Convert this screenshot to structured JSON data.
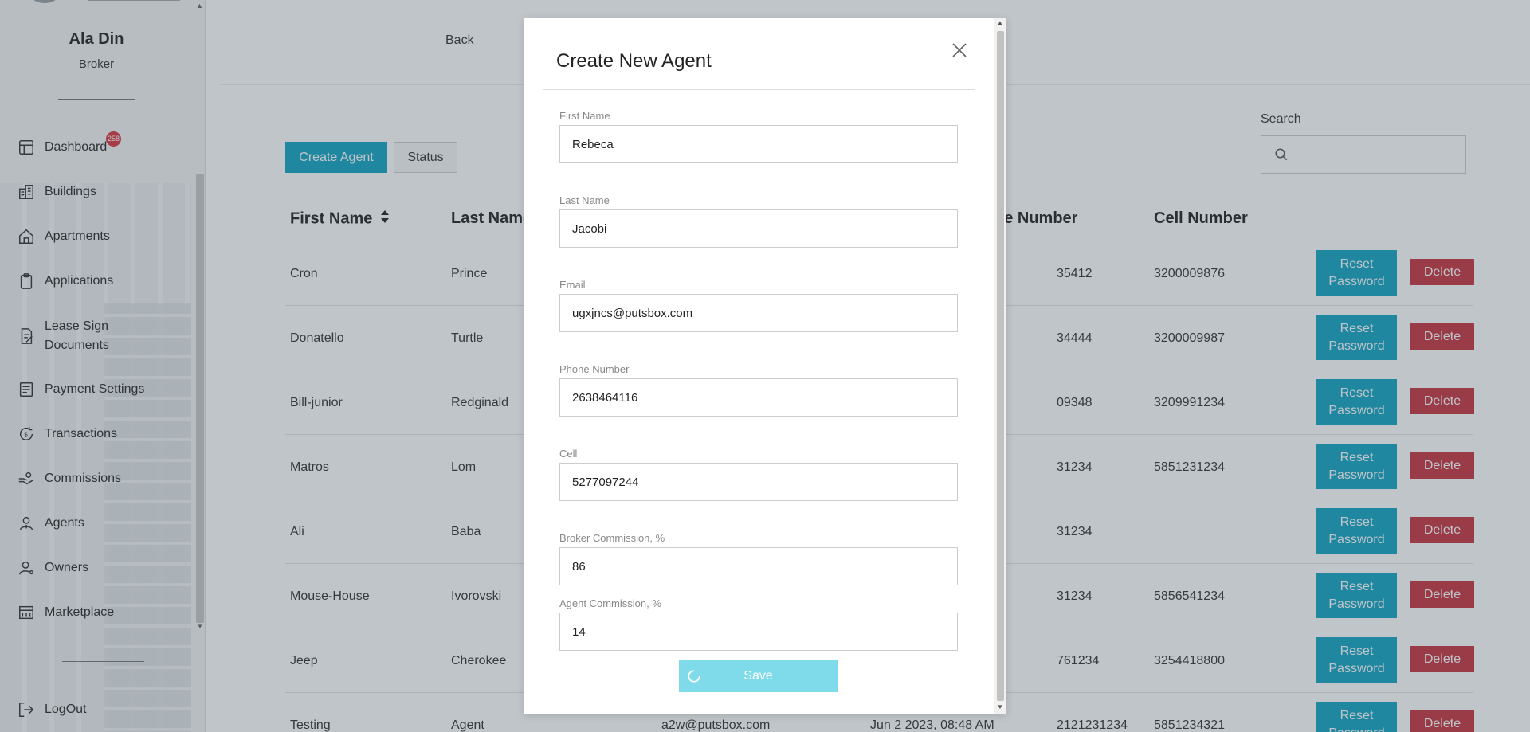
{
  "sidebar": {
    "user_name": "Ala Din",
    "user_role": "Broker",
    "items": [
      {
        "label": "Dashboard",
        "icon": "dashboard-icon",
        "badge": "258"
      },
      {
        "label": "Buildings",
        "icon": "buildings-icon"
      },
      {
        "label": "Apartments",
        "icon": "home-icon"
      },
      {
        "label": "Applications",
        "icon": "clipboard-icon"
      },
      {
        "label": "Lease Sign Documents",
        "icon": "document-sign-icon"
      },
      {
        "label": "Payment Settings",
        "icon": "payment-settings-icon"
      },
      {
        "label": "Transactions",
        "icon": "transactions-icon"
      },
      {
        "label": "Commissions",
        "icon": "commissions-icon"
      },
      {
        "label": "Agents",
        "icon": "agent-icon"
      },
      {
        "label": "Owners",
        "icon": "owner-icon"
      },
      {
        "label": "Marketplace",
        "icon": "marketplace-icon"
      }
    ],
    "logout_label": "LogOut"
  },
  "header": {
    "back_label": "Back"
  },
  "toolbar": {
    "create_label": "Create Agent",
    "status_label": "Status",
    "search_label": "Search",
    "search_value": ""
  },
  "table": {
    "headers": {
      "first_name": "First Name",
      "last_name": "Last Name",
      "phone_number": "ne Number",
      "cell_number": "Cell Number"
    },
    "reset_label": "Reset Password",
    "delete_label": "Delete",
    "rows": [
      {
        "first": "Cron",
        "last": "Prince",
        "email": "",
        "date": "",
        "phone": "35412",
        "cell": "3200009876"
      },
      {
        "first": "Donatello",
        "last": "Turtle",
        "email": "",
        "date": "",
        "phone": "34444",
        "cell": "3200009987"
      },
      {
        "first": "Bill-junior",
        "last": "Redginald",
        "email": "",
        "date": "",
        "phone": "09348",
        "cell": "3209991234"
      },
      {
        "first": "Matros",
        "last": "Lom",
        "email": "",
        "date": "",
        "phone": "31234",
        "cell": "5851231234"
      },
      {
        "first": "Ali",
        "last": "Baba",
        "email": "",
        "date": "",
        "phone": "31234",
        "cell": ""
      },
      {
        "first": "Mouse-House",
        "last": "Ivorovski",
        "email": "",
        "date": "",
        "phone": "31234",
        "cell": "5856541234"
      },
      {
        "first": "Jeep",
        "last": "Cherokee",
        "email": "",
        "date": "",
        "phone": "761234",
        "cell": "3254418800"
      },
      {
        "first": "Testing",
        "last": "Agent",
        "email": "a2w@putsbox.com",
        "date": "Jun 2 2023, 08:48 AM",
        "phone": "2121231234",
        "cell": "5851234321"
      }
    ]
  },
  "modal": {
    "title": "Create New Agent",
    "fields": [
      {
        "label": "First Name",
        "value": "Rebeca"
      },
      {
        "label": "Last Name",
        "value": "Jacobi"
      },
      {
        "label": "Email",
        "value": "ugxjncs@putsbox.com"
      },
      {
        "label": "Phone Number",
        "value": "2638464116"
      },
      {
        "label": "Cell",
        "value": "5277097244"
      },
      {
        "label": "Broker Commission, %",
        "value": "86"
      },
      {
        "label": "Agent Commission, %",
        "value": "14"
      }
    ],
    "save_label": "Save"
  },
  "colors": {
    "primary": "#13a4c0",
    "danger": "#c7353f",
    "save_disabled": "#7fdae9",
    "badge": "#d9363e"
  }
}
